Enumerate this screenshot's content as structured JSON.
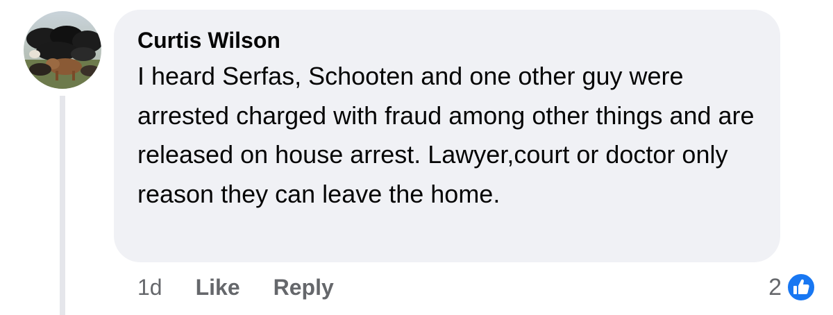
{
  "comment": {
    "author": "Curtis Wilson",
    "text": "I heard Serfas, Schooten and one other guy were arrested charged with fraud among other things and are released on house arrest. Lawyer,court or doctor only reason they can leave the home.",
    "timestamp": "1d",
    "like_label": "Like",
    "reply_label": "Reply",
    "reaction_count": "2",
    "reaction_icon": "thumbs-up-icon",
    "avatar_icon": "cattle-photo-avatar"
  },
  "colors": {
    "bubble_bg": "#f0f1f5",
    "text": "#050505",
    "meta_text": "#65676b",
    "like_blue": "#1877f2",
    "thread_line": "#e5e6eb"
  }
}
